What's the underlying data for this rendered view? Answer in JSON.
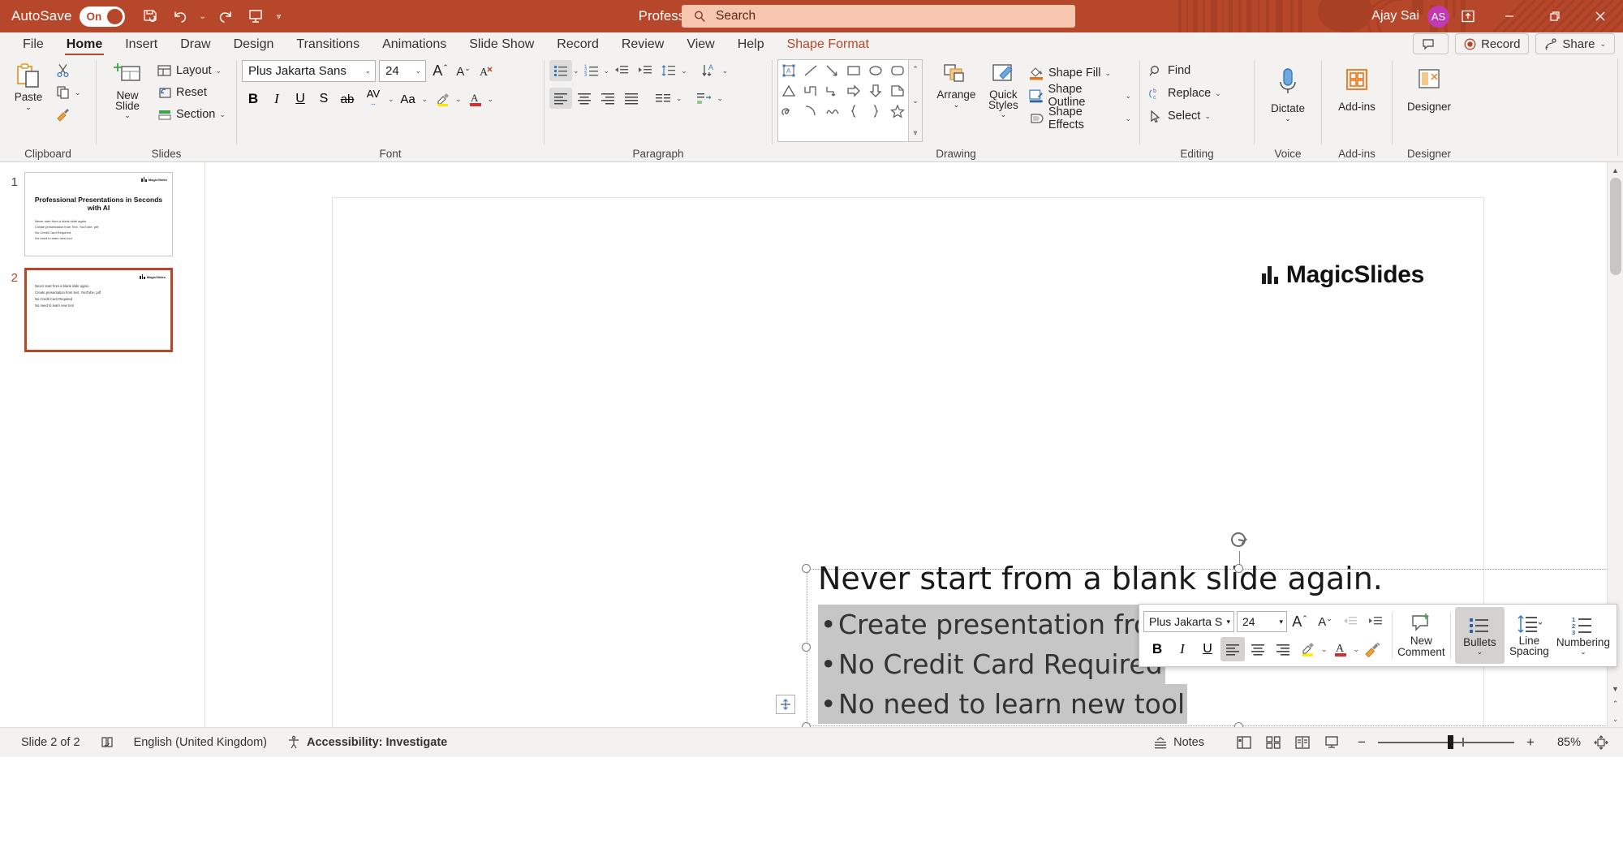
{
  "titlebar": {
    "autosave_label": "AutoSave",
    "autosave_state": "On",
    "doc_title": "Professional Presentations in Seconds with AI • Saved",
    "search_placeholder": "Search",
    "user_name": "Ajay Sai",
    "user_initials": "AS",
    "qat": [
      "save-icon",
      "undo-icon",
      "redo-icon",
      "present-icon",
      "customize-qat-icon"
    ],
    "window_buttons": [
      "minimize",
      "restore",
      "close"
    ]
  },
  "tabs": [
    {
      "label": "File",
      "active": false
    },
    {
      "label": "Home",
      "active": true
    },
    {
      "label": "Insert",
      "active": false
    },
    {
      "label": "Draw",
      "active": false
    },
    {
      "label": "Design",
      "active": false
    },
    {
      "label": "Transitions",
      "active": false
    },
    {
      "label": "Animations",
      "active": false
    },
    {
      "label": "Slide Show",
      "active": false
    },
    {
      "label": "Record",
      "active": false
    },
    {
      "label": "Review",
      "active": false
    },
    {
      "label": "View",
      "active": false
    },
    {
      "label": "Help",
      "active": false
    },
    {
      "label": "Shape Format",
      "active": false,
      "accent": true
    }
  ],
  "tabs_right": {
    "comments_label": "",
    "record_label": "Record",
    "share_label": "Share"
  },
  "ribbon": {
    "groups": [
      {
        "title": "Clipboard",
        "dialog": true
      },
      {
        "title": "Slides",
        "dialog": false
      },
      {
        "title": "Font",
        "dialog": true
      },
      {
        "title": "Paragraph",
        "dialog": true
      },
      {
        "title": "Drawing",
        "dialog": true
      },
      {
        "title": "Editing",
        "dialog": false
      },
      {
        "title": "Voice",
        "dialog": false
      },
      {
        "title": "Add-ins",
        "dialog": false
      },
      {
        "title": "Designer",
        "dialog": false
      }
    ],
    "clipboard": {
      "paste_label": "Paste",
      "cut_icon": "scissors-icon",
      "copy_icon": "copy-icon",
      "format_painter_icon": "format-painter-icon"
    },
    "slides": {
      "new_slide_label": "New Slide",
      "layout_label": "Layout",
      "reset_label": "Reset",
      "section_label": "Section"
    },
    "font": {
      "font_name": "Plus Jakarta Sans",
      "font_size": "24",
      "grow_icon": "increase-font-size-icon",
      "shrink_icon": "decrease-font-size-icon",
      "clear_format_icon": "clear-formatting-icon",
      "bold": "B",
      "italic": "I",
      "underline": "U",
      "shadow": "S",
      "strikethrough": "ab",
      "spacing": "AV",
      "change_case": "Aa",
      "highlight_icon": "text-highlight-icon",
      "fontcolor_icon": "font-color-icon"
    },
    "paragraph": {
      "bullets_icon": "bullets-icon",
      "numbering_icon": "numbering-icon",
      "decrease_indent_icon": "decrease-indent-icon",
      "increase_indent_icon": "increase-indent-icon",
      "line_spacing_icon": "line-spacing-icon",
      "text_direction_icon": "text-direction-icon",
      "align_text_icon": "align-text-icon",
      "smartart_icon": "convert-to-smartart-icon",
      "align_left_icon": "align-left-icon",
      "align_center_icon": "align-center-icon",
      "align_right_icon": "align-right-icon",
      "justify_icon": "justify-icon",
      "columns_icon": "columns-icon"
    },
    "drawing": {
      "arrange_label": "Arrange",
      "quick_styles_label": "Quick Styles",
      "shape_fill_label": "Shape Fill",
      "shape_outline_label": "Shape Outline",
      "shape_effects_label": "Shape Effects"
    },
    "editing": {
      "find_label": "Find",
      "replace_label": "Replace",
      "select_label": "Select"
    },
    "voice": {
      "dictate_label": "Dictate"
    },
    "addins": {
      "addins_label": "Add-ins"
    },
    "designer": {
      "designer_label": "Designer"
    }
  },
  "thumbnails": [
    {
      "number": "1",
      "selected": false,
      "title": "Professional Presentations in Seconds with AI",
      "bullets": [
        "Never start from a blank slide again.",
        "Create presentation from Text, YouTube, pdf",
        "No Credit Card Required",
        "No need to learn new tool"
      ],
      "logo": "MagicSlides"
    },
    {
      "number": "2",
      "selected": true,
      "title": "",
      "bullets": [
        "Never start from a blank slide again.",
        "Create presentation from text, YouTube, pdf",
        "No Credit Card Required",
        "No need to learn new tool"
      ],
      "logo": "MagicSlides"
    }
  ],
  "slide": {
    "logo_text": "MagicSlides",
    "title": "Never start from a blank slide again.",
    "bullets": [
      "Create presentation from t",
      "No Credit Card Required",
      "No need to learn new tool"
    ]
  },
  "mini_toolbar": {
    "font_name": "Plus Jakarta S",
    "font_size": "24",
    "grow_icon": "increase-font-size-icon",
    "shrink_icon": "decrease-font-size-icon",
    "decrease_indent_icon": "decrease-indent-icon",
    "increase_indent_icon": "increase-indent-icon",
    "bold": "B",
    "italic": "I",
    "underline": "U",
    "align_left_icon": "align-left-icon",
    "align_center_icon": "align-center-icon",
    "align_right_icon": "align-right-icon",
    "highlight_icon": "text-highlight-icon",
    "fontcolor_icon": "font-color-icon",
    "format_painter_icon": "format-painter-icon",
    "new_comment_label": "New Comment",
    "bullets_label": "Bullets",
    "line_spacing_label": "Line Spacing",
    "numbering_label": "Numbering"
  },
  "status": {
    "slide_counter": "Slide 2 of 2",
    "spellcheck_icon": "spellcheck-icon",
    "language": "English (United Kingdom)",
    "accessibility": "Accessibility: Investigate",
    "notes_label": "Notes",
    "views": [
      "normal-view-icon",
      "slide-sorter-icon",
      "reading-view-icon",
      "slide-show-icon"
    ],
    "zoom_value": "85%",
    "zoom_minus": "−",
    "zoom_plus": "+",
    "fit_icon": "fit-slide-to-window-icon"
  },
  "colors": {
    "accent": "#b7472a",
    "search_bg": "#f8c6ae",
    "ribbon_bg": "#f3f2f1",
    "avatar": "#c239b3",
    "selection_gray": "#c6c6c6"
  }
}
